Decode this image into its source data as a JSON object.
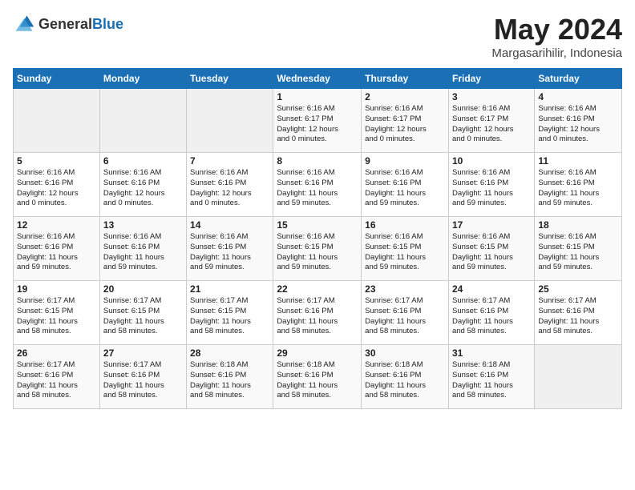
{
  "logo": {
    "general": "General",
    "blue": "Blue"
  },
  "title": "May 2024",
  "location": "Margasarihilir, Indonesia",
  "days_of_week": [
    "Sunday",
    "Monday",
    "Tuesday",
    "Wednesday",
    "Thursday",
    "Friday",
    "Saturday"
  ],
  "weeks": [
    [
      {
        "day": "",
        "info": ""
      },
      {
        "day": "",
        "info": ""
      },
      {
        "day": "",
        "info": ""
      },
      {
        "day": "1",
        "info": "Sunrise: 6:16 AM\nSunset: 6:17 PM\nDaylight: 12 hours\nand 0 minutes."
      },
      {
        "day": "2",
        "info": "Sunrise: 6:16 AM\nSunset: 6:17 PM\nDaylight: 12 hours\nand 0 minutes."
      },
      {
        "day": "3",
        "info": "Sunrise: 6:16 AM\nSunset: 6:17 PM\nDaylight: 12 hours\nand 0 minutes."
      },
      {
        "day": "4",
        "info": "Sunrise: 6:16 AM\nSunset: 6:16 PM\nDaylight: 12 hours\nand 0 minutes."
      }
    ],
    [
      {
        "day": "5",
        "info": "Sunrise: 6:16 AM\nSunset: 6:16 PM\nDaylight: 12 hours\nand 0 minutes."
      },
      {
        "day": "6",
        "info": "Sunrise: 6:16 AM\nSunset: 6:16 PM\nDaylight: 12 hours\nand 0 minutes."
      },
      {
        "day": "7",
        "info": "Sunrise: 6:16 AM\nSunset: 6:16 PM\nDaylight: 12 hours\nand 0 minutes."
      },
      {
        "day": "8",
        "info": "Sunrise: 6:16 AM\nSunset: 6:16 PM\nDaylight: 11 hours\nand 59 minutes."
      },
      {
        "day": "9",
        "info": "Sunrise: 6:16 AM\nSunset: 6:16 PM\nDaylight: 11 hours\nand 59 minutes."
      },
      {
        "day": "10",
        "info": "Sunrise: 6:16 AM\nSunset: 6:16 PM\nDaylight: 11 hours\nand 59 minutes."
      },
      {
        "day": "11",
        "info": "Sunrise: 6:16 AM\nSunset: 6:16 PM\nDaylight: 11 hours\nand 59 minutes."
      }
    ],
    [
      {
        "day": "12",
        "info": "Sunrise: 6:16 AM\nSunset: 6:16 PM\nDaylight: 11 hours\nand 59 minutes."
      },
      {
        "day": "13",
        "info": "Sunrise: 6:16 AM\nSunset: 6:16 PM\nDaylight: 11 hours\nand 59 minutes."
      },
      {
        "day": "14",
        "info": "Sunrise: 6:16 AM\nSunset: 6:16 PM\nDaylight: 11 hours\nand 59 minutes."
      },
      {
        "day": "15",
        "info": "Sunrise: 6:16 AM\nSunset: 6:15 PM\nDaylight: 11 hours\nand 59 minutes."
      },
      {
        "day": "16",
        "info": "Sunrise: 6:16 AM\nSunset: 6:15 PM\nDaylight: 11 hours\nand 59 minutes."
      },
      {
        "day": "17",
        "info": "Sunrise: 6:16 AM\nSunset: 6:15 PM\nDaylight: 11 hours\nand 59 minutes."
      },
      {
        "day": "18",
        "info": "Sunrise: 6:16 AM\nSunset: 6:15 PM\nDaylight: 11 hours\nand 59 minutes."
      }
    ],
    [
      {
        "day": "19",
        "info": "Sunrise: 6:17 AM\nSunset: 6:15 PM\nDaylight: 11 hours\nand 58 minutes."
      },
      {
        "day": "20",
        "info": "Sunrise: 6:17 AM\nSunset: 6:15 PM\nDaylight: 11 hours\nand 58 minutes."
      },
      {
        "day": "21",
        "info": "Sunrise: 6:17 AM\nSunset: 6:15 PM\nDaylight: 11 hours\nand 58 minutes."
      },
      {
        "day": "22",
        "info": "Sunrise: 6:17 AM\nSunset: 6:16 PM\nDaylight: 11 hours\nand 58 minutes."
      },
      {
        "day": "23",
        "info": "Sunrise: 6:17 AM\nSunset: 6:16 PM\nDaylight: 11 hours\nand 58 minutes."
      },
      {
        "day": "24",
        "info": "Sunrise: 6:17 AM\nSunset: 6:16 PM\nDaylight: 11 hours\nand 58 minutes."
      },
      {
        "day": "25",
        "info": "Sunrise: 6:17 AM\nSunset: 6:16 PM\nDaylight: 11 hours\nand 58 minutes."
      }
    ],
    [
      {
        "day": "26",
        "info": "Sunrise: 6:17 AM\nSunset: 6:16 PM\nDaylight: 11 hours\nand 58 minutes."
      },
      {
        "day": "27",
        "info": "Sunrise: 6:17 AM\nSunset: 6:16 PM\nDaylight: 11 hours\nand 58 minutes."
      },
      {
        "day": "28",
        "info": "Sunrise: 6:18 AM\nSunset: 6:16 PM\nDaylight: 11 hours\nand 58 minutes."
      },
      {
        "day": "29",
        "info": "Sunrise: 6:18 AM\nSunset: 6:16 PM\nDaylight: 11 hours\nand 58 minutes."
      },
      {
        "day": "30",
        "info": "Sunrise: 6:18 AM\nSunset: 6:16 PM\nDaylight: 11 hours\nand 58 minutes."
      },
      {
        "day": "31",
        "info": "Sunrise: 6:18 AM\nSunset: 6:16 PM\nDaylight: 11 hours\nand 58 minutes."
      },
      {
        "day": "",
        "info": ""
      }
    ]
  ]
}
